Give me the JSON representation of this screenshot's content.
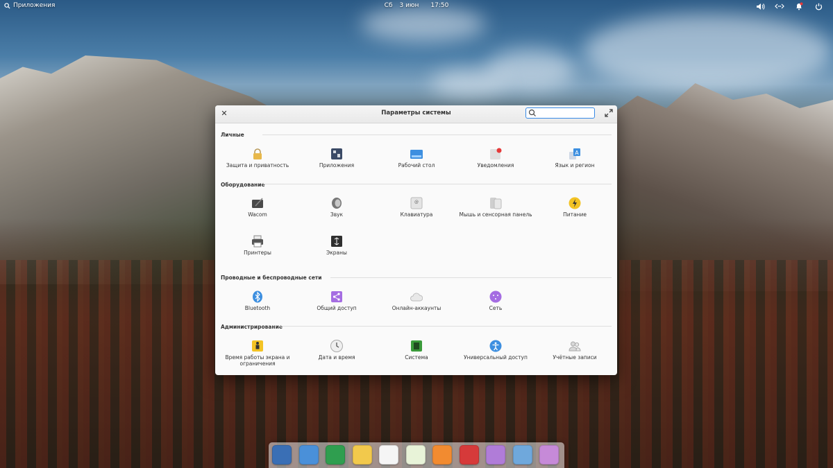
{
  "panel": {
    "apps_label": "Приложения",
    "day": "Сб",
    "date": "3 июн",
    "time": "17:50",
    "tray_icons": [
      "volume-icon",
      "network-icon",
      "notifications-icon",
      "power-icon"
    ]
  },
  "window": {
    "title": "Параметры системы",
    "search_value": "",
    "sections": {
      "personal": {
        "title": "Личные",
        "items": [
          {
            "label": "Защита и приватность",
            "icon": "lock-icon"
          },
          {
            "label": "Приложения",
            "icon": "applications-icon"
          },
          {
            "label": "Рабочий стол",
            "icon": "desktop-icon"
          },
          {
            "label": "Уведомления",
            "icon": "notifications-icon"
          },
          {
            "label": "Язык и регион",
            "icon": "language-icon"
          }
        ]
      },
      "hardware": {
        "title": "Оборудование",
        "items": [
          {
            "label": "Wacom",
            "icon": "tablet-icon"
          },
          {
            "label": "Звук",
            "icon": "speaker-icon"
          },
          {
            "label": "Клавиатура",
            "icon": "keyboard-icon"
          },
          {
            "label": "Мышь и сенсорная панель",
            "icon": "mouse-icon"
          },
          {
            "label": "Питание",
            "icon": "power-icon"
          },
          {
            "label": "Принтеры",
            "icon": "printer-icon"
          },
          {
            "label": "Экраны",
            "icon": "display-icon"
          }
        ]
      },
      "network": {
        "title": "Проводные и беспроводные сети",
        "items": [
          {
            "label": "Bluetooth",
            "icon": "bluetooth-icon"
          },
          {
            "label": "Общий доступ",
            "icon": "sharing-icon"
          },
          {
            "label": "Онлайн-аккаунты",
            "icon": "cloud-icon"
          },
          {
            "label": "Сеть",
            "icon": "network-icon"
          }
        ]
      },
      "admin": {
        "title": "Администрирование",
        "items": [
          {
            "label": "Время работы экрана и ограничения",
            "icon": "screen-time-icon"
          },
          {
            "label": "Дата и время",
            "icon": "clock-icon"
          },
          {
            "label": "Система",
            "icon": "system-icon"
          },
          {
            "label": "Универсальный доступ",
            "icon": "accessibility-icon"
          },
          {
            "label": "Учётные записи",
            "icon": "users-icon"
          }
        ]
      }
    }
  },
  "dock": {
    "apps": [
      {
        "name": "multitasking-view-icon",
        "color": "#3a6fb5"
      },
      {
        "name": "files-icon",
        "color": "#4a90d9"
      },
      {
        "name": "web-browser-icon",
        "color": "#2f9e4f"
      },
      {
        "name": "mail-icon",
        "color": "#f2c94c"
      },
      {
        "name": "tasks-icon",
        "color": "#f5f5f5"
      },
      {
        "name": "calendar-icon",
        "color": "#e8f3d8"
      },
      {
        "name": "music-icon",
        "color": "#f28b30"
      },
      {
        "name": "videos-icon",
        "color": "#d63a3a"
      },
      {
        "name": "photos-icon",
        "color": "#b07cd8"
      },
      {
        "name": "settings-icon",
        "color": "#6fa8dc"
      },
      {
        "name": "appcenter-icon",
        "color": "#c68ad8"
      }
    ]
  }
}
